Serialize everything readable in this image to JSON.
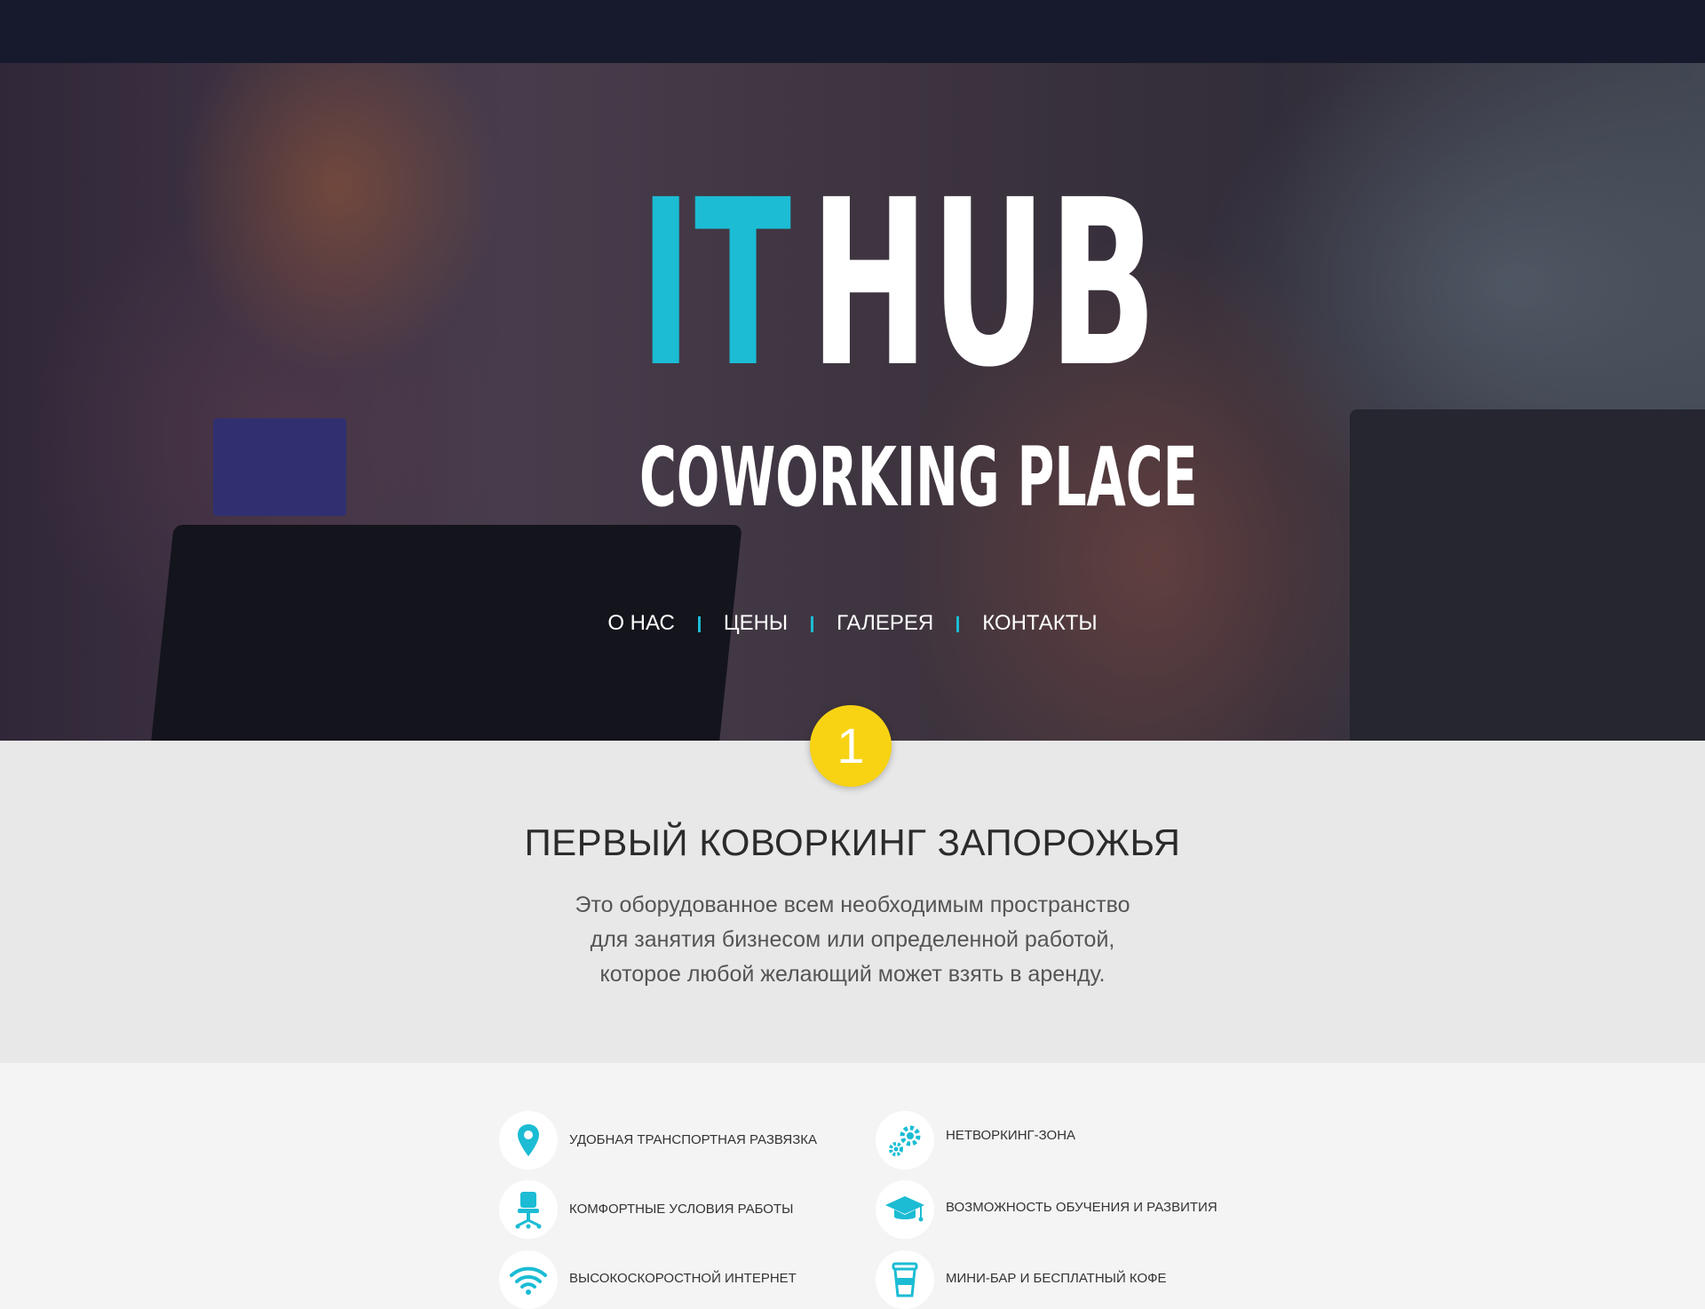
{
  "brand": {
    "word1": "IT",
    "word2": "HUB",
    "tagline": "COWORKING PLACE"
  },
  "nav": [
    "О НАС",
    "ЦЕНЫ",
    "ГАЛЕРЕЯ",
    "КОНТАКТЫ"
  ],
  "section_badge": "1",
  "about": {
    "title": "ПЕРВЫЙ КОВОРКИНГ ЗАПОРОЖЬЯ",
    "text": [
      "Это оборудованное всем необходимым пространство",
      "для занятия бизнесом или определенной работой,",
      "которое любой желающий может взять в аренду."
    ]
  },
  "features": [
    {
      "label": "Удобная транспортная развязка",
      "icon": "map-pin-icon"
    },
    {
      "label": "Нетворкинг-зона",
      "icon": "gears-icon"
    },
    {
      "label": "Комфортные условия работы",
      "icon": "office-chair-icon"
    },
    {
      "label": "Возможность обучения и развития",
      "icon": "graduation-cap-icon"
    },
    {
      "label": "Высокоскоростной интернет",
      "icon": "wifi-icon"
    },
    {
      "label": "Мини-бар и бесплатный кофе",
      "icon": "coffee-cup-icon"
    }
  ],
  "colors": {
    "accent": "#1bbcd4",
    "badge": "#f7d313",
    "topbar": "#161a2c"
  }
}
